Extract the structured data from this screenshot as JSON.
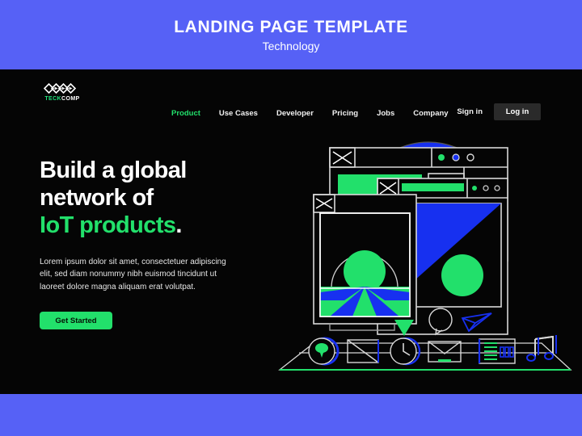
{
  "banner": {
    "title": "LANDING PAGE TEMPLATE",
    "subtitle": "Technology"
  },
  "brand": {
    "name_part1": "TECK",
    "name_part2": "COMP",
    "logo_icon": "chevron-diamond-logo-icon"
  },
  "nav": {
    "links": [
      {
        "label": "Product",
        "active": true
      },
      {
        "label": "Use Cases",
        "active": false
      },
      {
        "label": "Developer",
        "active": false
      },
      {
        "label": "Pricing",
        "active": false
      },
      {
        "label": "Jobs",
        "active": false
      },
      {
        "label": "Company",
        "active": false
      }
    ],
    "sign_in_label": "Sign in",
    "log_in_label": "Log in"
  },
  "hero": {
    "headline_line1": "Build a global",
    "headline_line2": "network of",
    "headline_accent": "IoT products",
    "headline_period": ".",
    "paragraph": "Lorem ipsum dolor sit amet, consectetuer adipiscing elit, sed diam nonummy nibh euismod tincidunt ut laoreet dolore magna aliquam erat volutpat.",
    "cta_label": "Get Started"
  },
  "illustration": {
    "name": "iot-browser-windows-illustration",
    "icons": [
      "chat-bubble-icon",
      "image-placeholder-icon",
      "clock-icon",
      "envelope-icon",
      "bar-chart-icon",
      "music-notes-icon"
    ],
    "floating_icons": [
      "speech-bubble-icon",
      "paper-plane-icon",
      "download-arrow-icon"
    ]
  },
  "colors": {
    "page_background": "#5661f6",
    "card_background": "#050505",
    "accent_green": "#22e06b",
    "accent_blue": "#1730f0",
    "text_light": "#ffffff",
    "button_dark": "#2a2a2a"
  }
}
